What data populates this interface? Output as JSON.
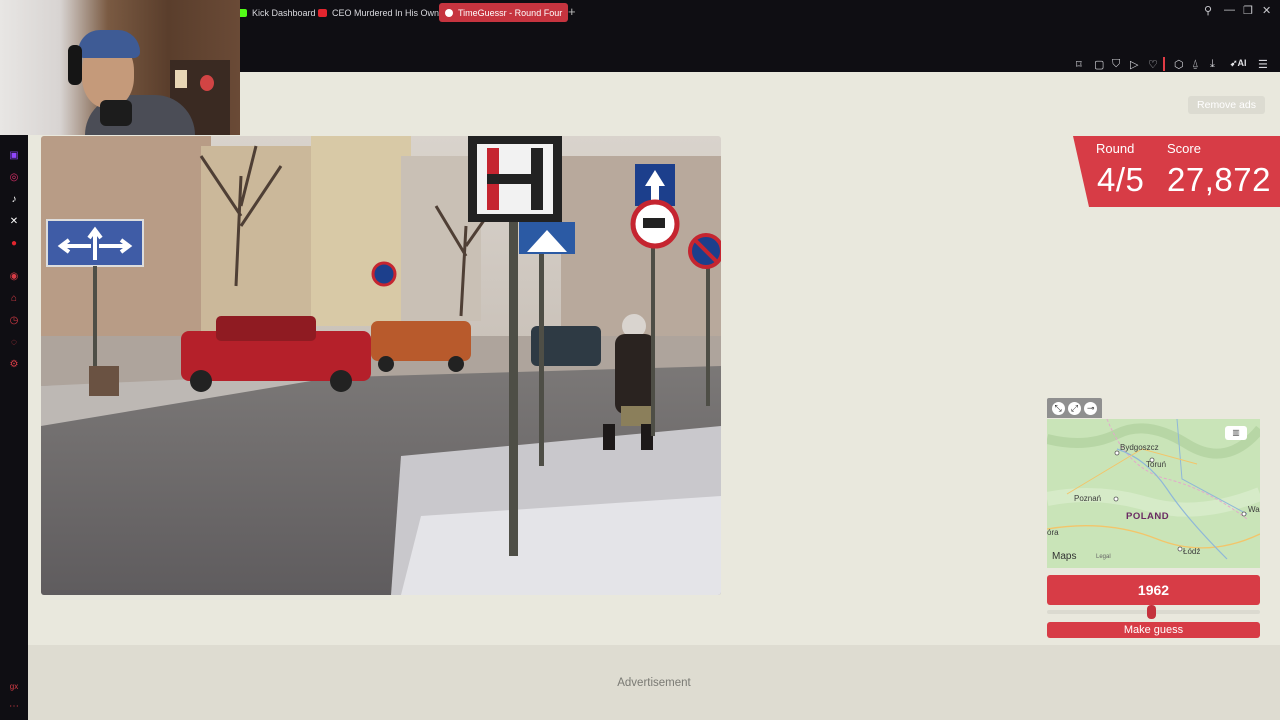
{
  "browser": {
    "tabs": [
      {
        "label": "Kick Dashboard",
        "icon": "kick-icon",
        "active": false
      },
      {
        "label": "CEO Murdered In His Own",
        "icon": "youtube-icon",
        "active": false
      },
      {
        "label": "TimeGuessr - Round Four",
        "icon": "timeguessr-icon",
        "active": true
      }
    ],
    "new_tab": "+",
    "ai_label": "AI",
    "accent": "#c6343f"
  },
  "sidebar": {
    "icons": [
      "twitch-icon",
      "instagram-icon",
      "tiktok-icon",
      "x-icon",
      "youtube-icon",
      "player-icon",
      "pin-icon",
      "history-icon",
      "chat-icon",
      "settings-icon"
    ],
    "bottom_icons": [
      "gx-icon",
      "more-icon"
    ]
  },
  "page": {
    "remove_ads": "Remove ads",
    "round_label": "Round",
    "round_value": "4/5",
    "score_label": "Score",
    "score_value": "27,872",
    "map": {
      "cities": [
        "Bydgoszcz",
        "Toruń",
        "Poznań",
        "Łódź",
        "Wa",
        "óra"
      ],
      "country": "POLAND",
      "brand": "Maps",
      "legal": "Legal"
    },
    "year": "1962",
    "slider_fraction": 0.49,
    "make_guess": "Make guess",
    "advertisement": "Advertisement",
    "brand_color": "#d73c46"
  }
}
